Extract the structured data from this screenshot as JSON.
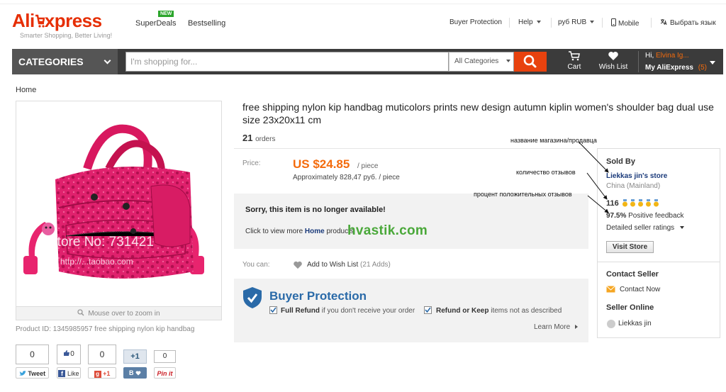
{
  "header": {
    "logo_ali": "Ali",
    "logo_express": "xpress",
    "tagline": "Smarter Shopping, Better Living!",
    "new_badge": "NEW",
    "nav": [
      {
        "label": "SuperDeals"
      },
      {
        "label": "Bestselling"
      }
    ],
    "buyer_protection": "Buyer Protection",
    "help": "Help",
    "currency": "руб RUB",
    "mobile": "Mobile",
    "language": "Выбрать язык"
  },
  "search": {
    "categories_label": "CATEGORIES",
    "placeholder": "I'm shopping for...",
    "category_select": "All Categories",
    "cart_label": "Cart",
    "wishlist_label": "Wish List",
    "greeting": "Hi,",
    "user_name": "Elvina Ig...",
    "my_aliexpress": "My AliExpress",
    "my_aliexpress_count": "(5)"
  },
  "breadcrumb": "Home",
  "product": {
    "title": "free shipping nylon kip handbag muticolors prints new design autumn kiplin women's shoulder bag dual use size 23x20x11 cm",
    "orders_count": "21",
    "orders_label": "orders",
    "price_label": "Price:",
    "price": "US $24.85",
    "per_piece": "/ piece",
    "approx": "Approximately 828,47 руб. / piece",
    "unavailable_title": "Sorry, this item is no longer available!",
    "unavailable_sub_prefix": "Click to view more",
    "unavailable_sub_link": "Home",
    "unavailable_sub_suffix": "products",
    "you_can": "You can:",
    "add_wishlist": "Add to Wish List",
    "wishlist_adds": "(21 Adds)",
    "image_watermark_store": "Store No: 731421",
    "image_watermark_url": "http://...taobao.com",
    "zoom_hint": "Mouse over to zoom in",
    "product_id": "Product ID: 1345985957 free shipping nylon kip handbag"
  },
  "buyer_protection": {
    "title": "Buyer Protection",
    "full_refund_bold": "Full Refund",
    "full_refund_rest": "if you don't receive your order",
    "refund_keep_bold": "Refund or Keep",
    "refund_keep_rest": "items not as described",
    "learn_more": "Learn More"
  },
  "seller": {
    "sold_by": "Sold By",
    "store_name": "Liekkas jin's store",
    "country": "China (Mainland)",
    "feedback_count": "116",
    "positive_pct": "97.5%",
    "positive_label": "Positive feedback",
    "detailed": "Detailed seller ratings",
    "visit_store": "Visit Store",
    "contact_seller": "Contact Seller",
    "contact_now": "Contact Now",
    "seller_online": "Seller Online",
    "seller_name": "Liekkas jin"
  },
  "social": {
    "tweet_count": "0",
    "tweet_label": "Tweet",
    "fb_count": "0",
    "fb_label": "Like",
    "gplus_count": "0",
    "gplus_label": "+1",
    "vk_count": "+1",
    "pin_count": "0",
    "pin_label": "Pin it"
  },
  "annotations": {
    "store_name": "название магазина/продавца",
    "reviews_count": "количество отзывов",
    "positive_pct": "процент положительных отзывов"
  },
  "watermark": "hvastik.com",
  "colors": {
    "brand_red": "#e62e04",
    "price_orange": "#f46b0c",
    "search_button": "#e8420e",
    "buyer_protection_blue": "#2a6aa8"
  }
}
